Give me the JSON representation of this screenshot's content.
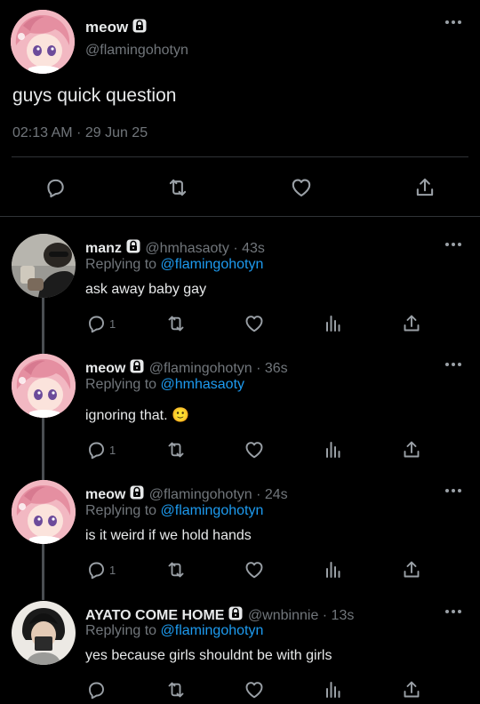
{
  "main_tweet": {
    "name": "meow",
    "handle": "@flamingohotyn",
    "text": "guys quick question",
    "timestamp": "02:13 AM · 29 Jun 25"
  },
  "replies": [
    {
      "name": "manz",
      "meta": "@hmhasaoty · 43s",
      "replying_prefix": "Replying to ",
      "replying_to": "@flamingohotyn",
      "text": "ask away baby gay",
      "reply_count": "1"
    },
    {
      "name": "meow",
      "meta": "@flamingohotyn · 36s",
      "replying_prefix": "Replying to ",
      "replying_to": "@hmhasaoty",
      "text": "ignoring that. 🙂",
      "reply_count": "1"
    },
    {
      "name": "meow",
      "meta": "@flamingohotyn · 24s",
      "replying_prefix": "Replying to ",
      "replying_to": "@flamingohotyn",
      "text": "is it weird if we hold hands",
      "reply_count": "1"
    },
    {
      "name": "AYATO COME HOME",
      "meta": "@wnbinnie · 13s",
      "replying_prefix": "Replying to ",
      "replying_to": "@flamingohotyn",
      "text": "yes because girls shouldnt be with girls",
      "reply_count": ""
    }
  ],
  "icons": {
    "lock": "lock-icon",
    "reply": "reply-icon",
    "retweet": "retweet-icon",
    "like": "heart-icon",
    "views": "views-icon",
    "share": "share-icon",
    "more": "more-icon"
  },
  "colors": {
    "background": "#000000",
    "text": "#e7e9ea",
    "muted": "#71767b",
    "link": "#1d9bf0",
    "divider": "#2f3336"
  }
}
